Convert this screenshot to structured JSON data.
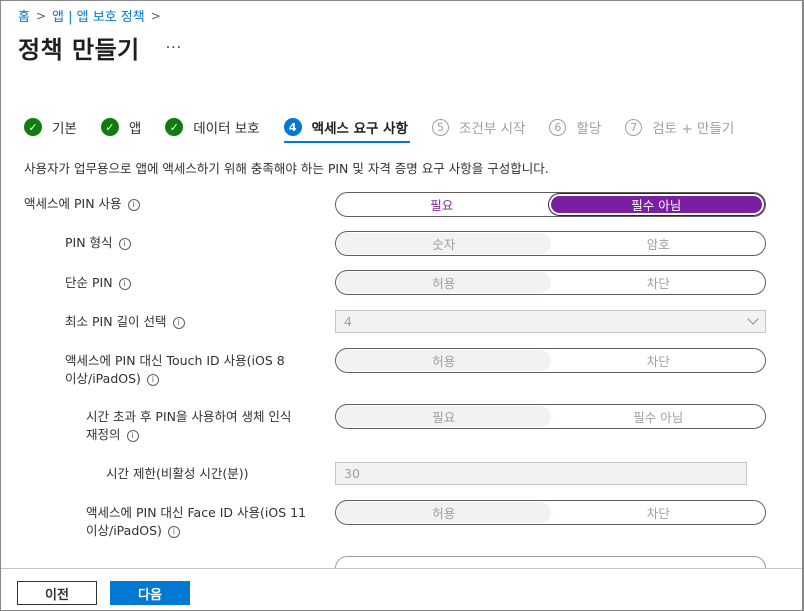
{
  "breadcrumb": [
    "홈",
    "앱 | 앱 보호 정책"
  ],
  "page_title": "정책 만들기",
  "more_label": "···",
  "steps": [
    {
      "num": "✓",
      "label": "기본"
    },
    {
      "num": "✓",
      "label": "앱"
    },
    {
      "num": "✓",
      "label": "데이터 보호"
    },
    {
      "num": "4",
      "label": "액세스 요구 사항"
    },
    {
      "num": "5",
      "label": "조건부 시작"
    },
    {
      "num": "6",
      "label": "할당"
    },
    {
      "num": "7",
      "label": "검토 + 만들기"
    }
  ],
  "description": "사용자가 업무용으로 앱에 액세스하기 위해 충족해야 하는 PIN 및 자격 증명 요구 사항을 구성합니다.",
  "settings": {
    "pin_access": {
      "label": "액세스에 PIN 사용",
      "left": "필요",
      "right": "필수 아님"
    },
    "pin_type": {
      "label": "PIN 형식",
      "left": "숫자",
      "right": "암호"
    },
    "simple_pin": {
      "label": "단순 PIN",
      "left": "허용",
      "right": "차단"
    },
    "min_pin_length": {
      "label": "최소 PIN 길이 선택",
      "value": "4"
    },
    "touch_id": {
      "label_line1": "액세스에 PIN 대신 Touch ID 사용(iOS 8",
      "label_line2": "이상/iPadOS)",
      "left": "허용",
      "right": "차단"
    },
    "override_biometric": {
      "label_line1": "시간 초과 후 PIN을 사용하여 생체 인식",
      "label_line2": "재정의",
      "left": "필요",
      "right": "필수 아님"
    },
    "timeout": {
      "label": "시간 제한(비활성 시간(분))",
      "value": "30"
    },
    "face_id": {
      "label_line1": "액세스에 PIN 대신 Face ID 사용(iOS 11",
      "label_line2": "이상/iPadOS)",
      "left": "허용",
      "right": "차단"
    }
  },
  "footer": {
    "prev": "이전",
    "next": "다음"
  },
  "colors": {
    "accent": "#0078d4",
    "selected_toggle": "#7a1fa2",
    "done": "#107c10"
  }
}
